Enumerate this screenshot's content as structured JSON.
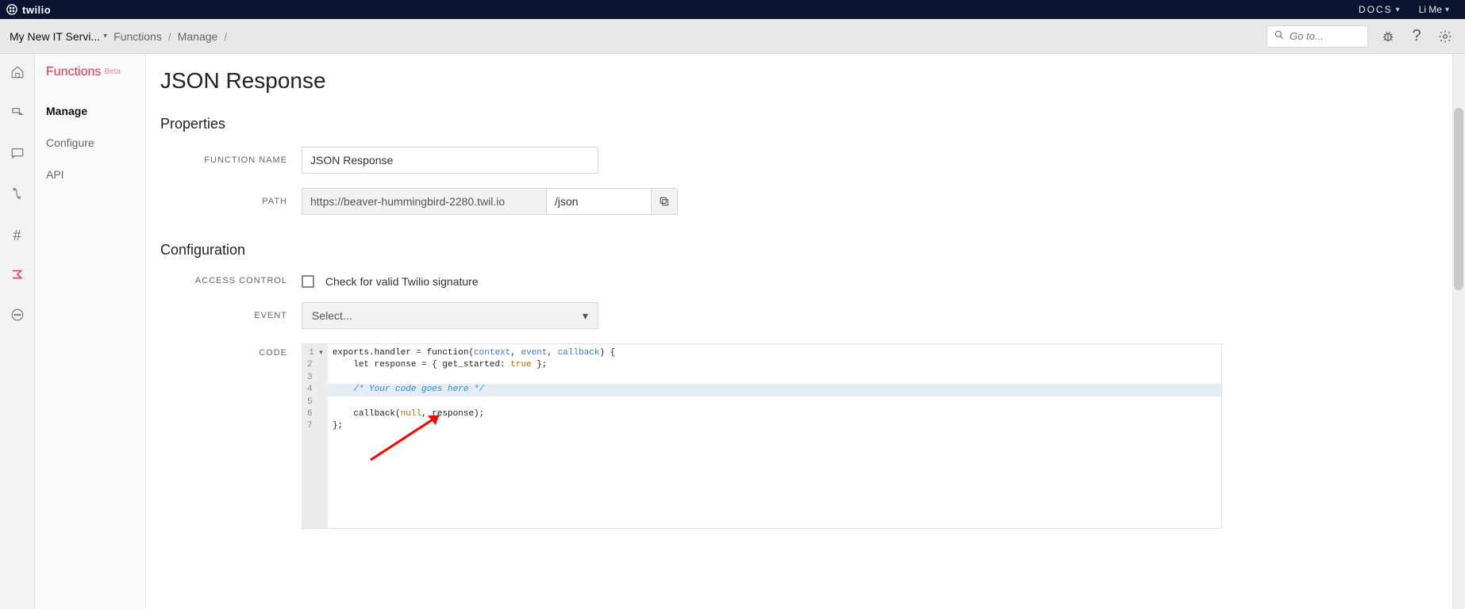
{
  "topbar": {
    "brand": "twilio",
    "docs": "DOCS",
    "user": "Li Me"
  },
  "breadcrumb": {
    "project": "My New IT Servi...",
    "items": [
      "Functions",
      "Manage"
    ]
  },
  "search": {
    "placeholder": "Go to..."
  },
  "sidebar": {
    "title": "Functions",
    "badge": "Beta",
    "items": [
      {
        "label": "Manage",
        "active": true
      },
      {
        "label": "Configure",
        "active": false
      },
      {
        "label": "API",
        "active": false
      }
    ]
  },
  "page": {
    "title": "JSON Response",
    "properties_heading": "Properties",
    "configuration_heading": "Configuration",
    "labels": {
      "function_name": "FUNCTION NAME",
      "path": "PATH",
      "access_control": "ACCESS CONTROL",
      "event": "EVENT",
      "code": "CODE"
    },
    "function_name_value": "JSON Response",
    "path_host": "https://beaver-hummingbird-2280.twil.io",
    "path_value": "/json",
    "access_control_label": "Check for valid Twilio signature",
    "event_placeholder": "Select...",
    "code": {
      "l1a": "exports.handler = ",
      "l1b": "function",
      "l1c": "(",
      "l1_ctx": "context",
      "l1_sep1": ", ",
      "l1_evt": "event",
      "l1_sep2": ", ",
      "l1_cb": "callback",
      "l1d": ") {",
      "l2a": "    let response = { get_started: ",
      "l2_true": "true",
      "l2b": " };",
      "l3": "",
      "l4": "/* Your code goes here */",
      "l5": "",
      "l6a": "    callback(",
      "l6_null": "null",
      "l6b": ", response);",
      "l7": "};"
    }
  }
}
